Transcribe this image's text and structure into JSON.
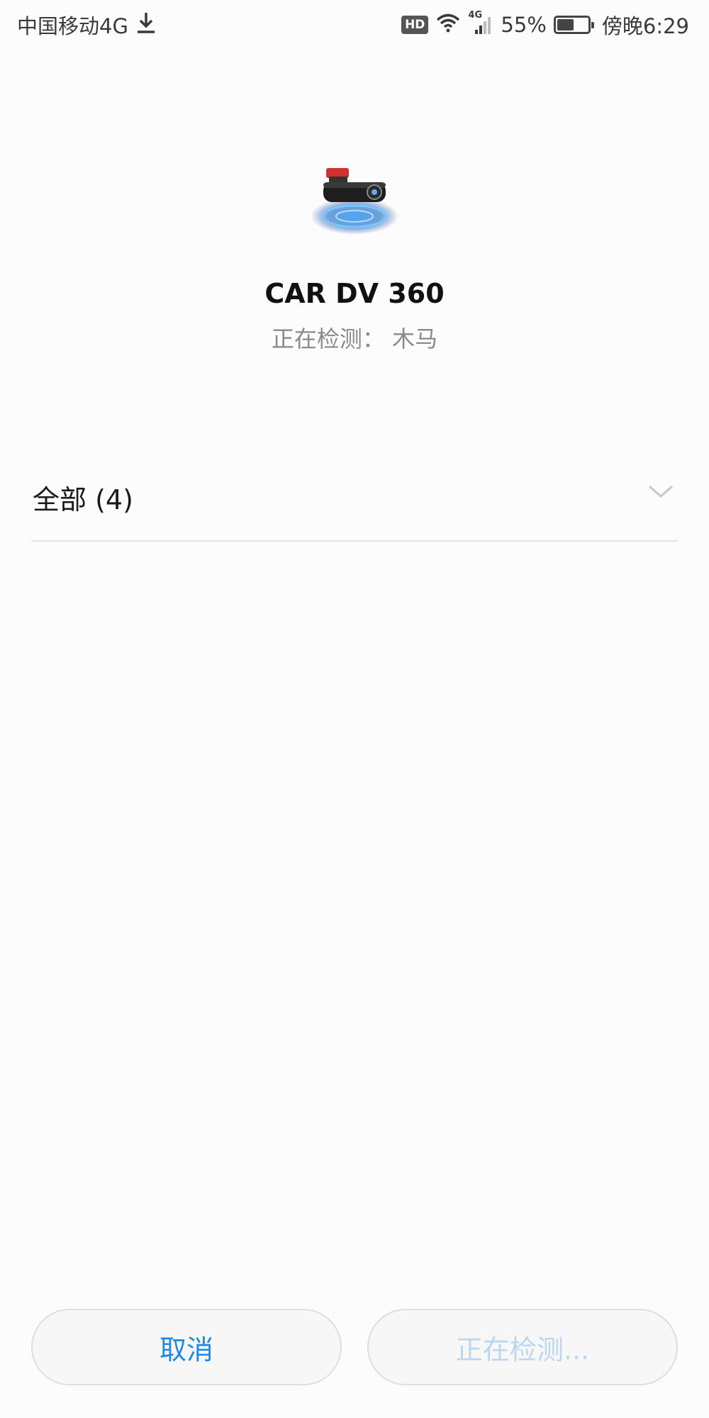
{
  "status_bar": {
    "carrier": "中国移动4G",
    "download_icon": "download-arrow-icon",
    "hd_badge": "HD",
    "wifi_icon": "wifi-icon",
    "network_label": "4G",
    "signal_icon": "cell-signal-icon",
    "battery_percent": "55%",
    "battery_level": 0.55,
    "time": "傍晚6:29"
  },
  "header": {
    "device_image": "dash-camera-icon",
    "app_name": "CAR DV 360",
    "scan_status": "正在检测： 木马"
  },
  "filter": {
    "label": "全部 (4)",
    "dropdown_icon": "chevron-down-icon"
  },
  "buttons": {
    "cancel": "取消",
    "detecting": "正在检测..."
  },
  "colors": {
    "accent": "#1e88e5",
    "disabled_text": "#bcd6f2",
    "background": "#fcfcfc"
  }
}
